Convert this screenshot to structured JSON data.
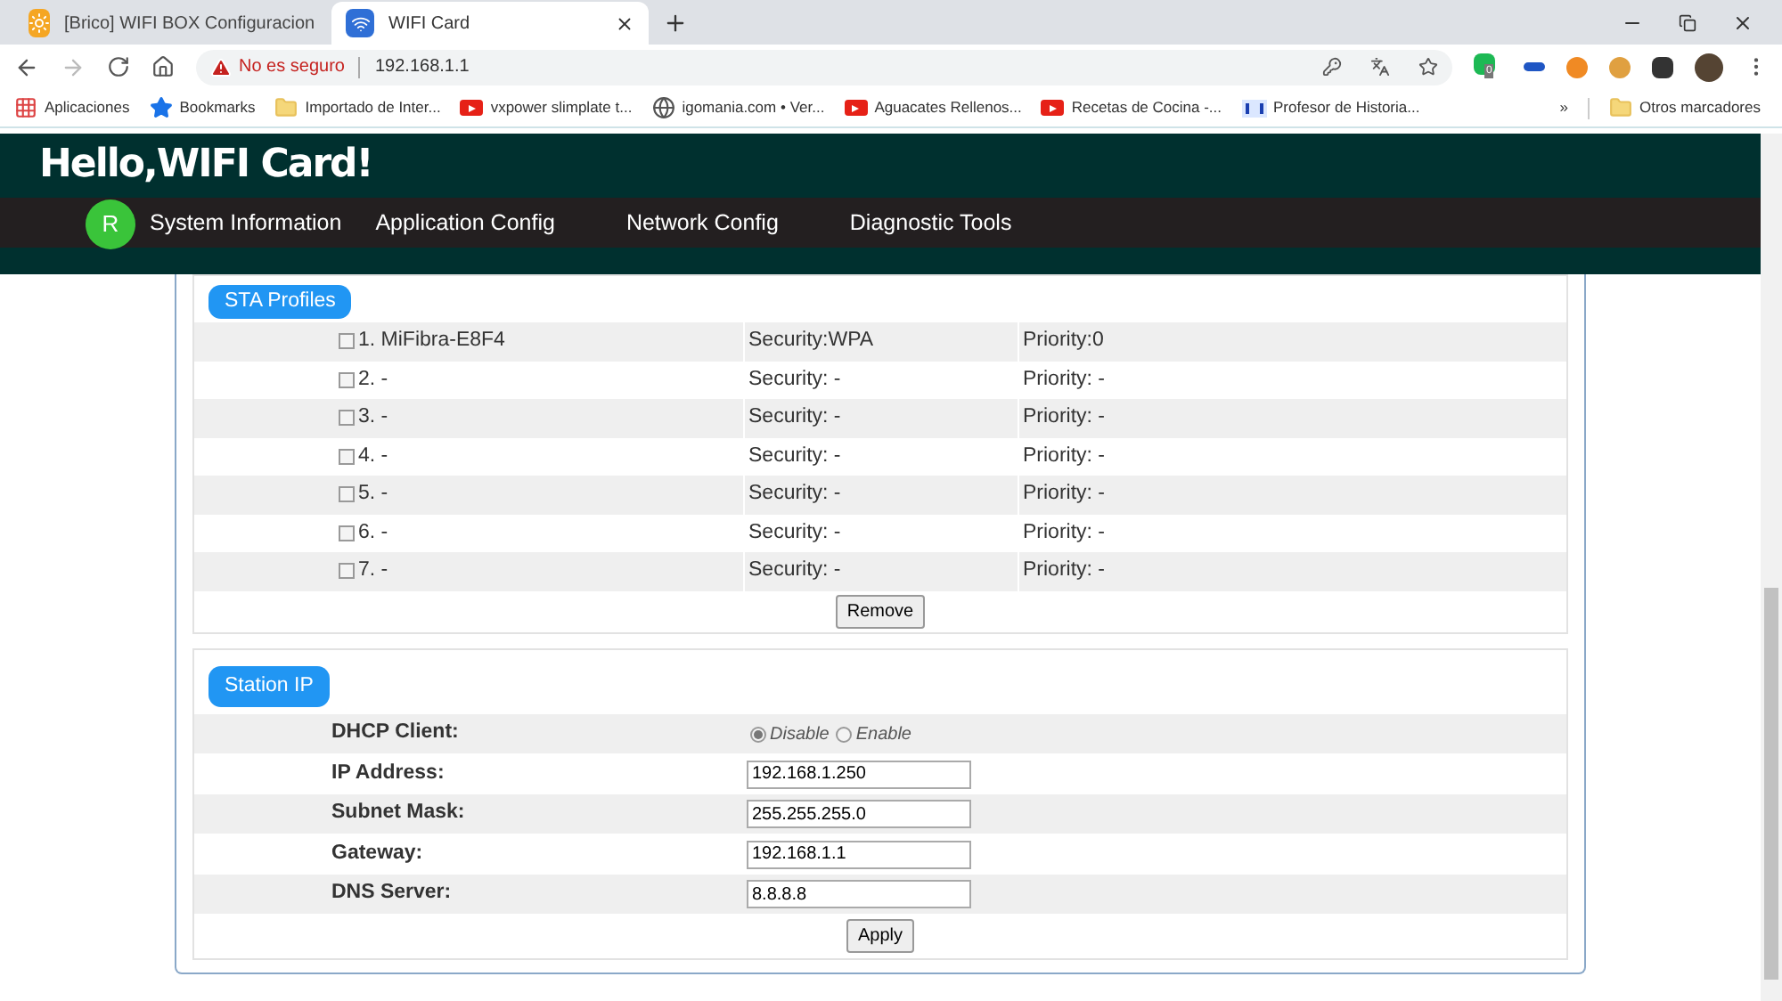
{
  "browser": {
    "tabs": [
      {
        "title": "[Brico] WIFI BOX Configuracion",
        "selected": false,
        "kind": "sun"
      },
      {
        "title": "WIFI Card",
        "selected": true,
        "kind": "wifi"
      }
    ],
    "address": {
      "warning": "No es seguro",
      "url": "192.168.1.1"
    },
    "extension_badge": "0",
    "bookmarks": [
      {
        "label": "Aplicaciones",
        "kind": "apps"
      },
      {
        "label": "Bookmarks",
        "kind": "star"
      },
      {
        "label": "Importado de Inter...",
        "kind": "folder"
      },
      {
        "label": "vxpower slimplate t...",
        "kind": "video"
      },
      {
        "label": "igomania.com • Ver...",
        "kind": "globe"
      },
      {
        "label": "Aguacates Rellenos...",
        "kind": "video"
      },
      {
        "label": "Recetas de Cocina -...",
        "kind": "video"
      },
      {
        "label": "Profesor de Historia...",
        "kind": "ph"
      }
    ],
    "bookmarks_overflow": "»",
    "other_bookmarks": "Otros marcadores"
  },
  "header": {
    "title": "Hello,WIFI Card!",
    "avatar": "R",
    "nav": [
      "System Information",
      "Application Config",
      "Network Config",
      "Diagnostic Tools"
    ]
  },
  "sta_profiles": {
    "title": "STA Profiles",
    "rows": [
      {
        "label": "1. MiFibra-E8F4",
        "checked": false,
        "security": "Security:WPA",
        "priority": "Priority:0"
      },
      {
        "label": "2. -",
        "checked": false,
        "security": "Security: -",
        "priority": "Priority: -"
      },
      {
        "label": "3. -",
        "checked": false,
        "security": "Security: -",
        "priority": "Priority: -"
      },
      {
        "label": "4. -",
        "checked": false,
        "security": "Security: -",
        "priority": "Priority: -"
      },
      {
        "label": "5. -",
        "checked": false,
        "security": "Security: -",
        "priority": "Priority: -"
      },
      {
        "label": "6. -",
        "checked": false,
        "security": "Security: -",
        "priority": "Priority: -"
      },
      {
        "label": "7. -",
        "checked": false,
        "security": "Security: -",
        "priority": "Priority: -"
      }
    ],
    "button": "Remove"
  },
  "station_ip": {
    "title": "Station IP",
    "dhcp": {
      "label": "DHCP Client:",
      "options": [
        {
          "label": "Disable",
          "selected": true
        },
        {
          "label": "Enable",
          "selected": false
        }
      ]
    },
    "fields": [
      {
        "label": "IP Address:",
        "value": "192.168.1.250"
      },
      {
        "label": "Subnet Mask:",
        "value": "255.255.255.0"
      },
      {
        "label": "Gateway:",
        "value": "192.168.1.1"
      },
      {
        "label": "DNS Server:",
        "value": "8.8.8.8"
      }
    ],
    "button": "Apply"
  }
}
